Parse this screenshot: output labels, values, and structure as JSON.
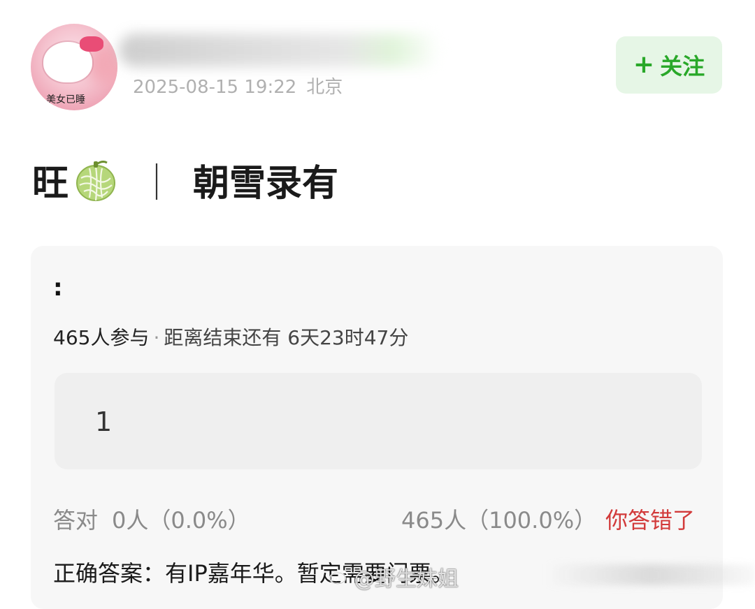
{
  "post": {
    "meta": {
      "datetime": "2025-08-15 19:22",
      "location": "北京"
    },
    "author": {
      "avatar_caption": "美女已睡"
    },
    "follow_label": "关注",
    "follow_plus": "+",
    "title": {
      "prefix": "旺",
      "emoji": "melon-icon",
      "separator": "｜",
      "text": "朝雪录有"
    }
  },
  "quiz": {
    "question": ":",
    "participants": "465人参与",
    "dot": "·",
    "remaining": "距离结束还有 6天23时47分",
    "options": [
      {
        "label": "1"
      }
    ],
    "correct_label": "答对",
    "correct_count": "0人（0.0%）",
    "option_count": "465人（100.0%）",
    "result_status": "你答错了",
    "answer_text": "正确答案：有IP嘉年华。暂定需要门票。"
  },
  "watermark": {
    "text": "@野生妹姐"
  },
  "colors": {
    "follow_green": "#29a829",
    "follow_bg": "#e6f6e6",
    "wrong_red": "#d23a3a",
    "meta_gray": "#b0b0b0",
    "card_bg": "#f7f7f7"
  }
}
